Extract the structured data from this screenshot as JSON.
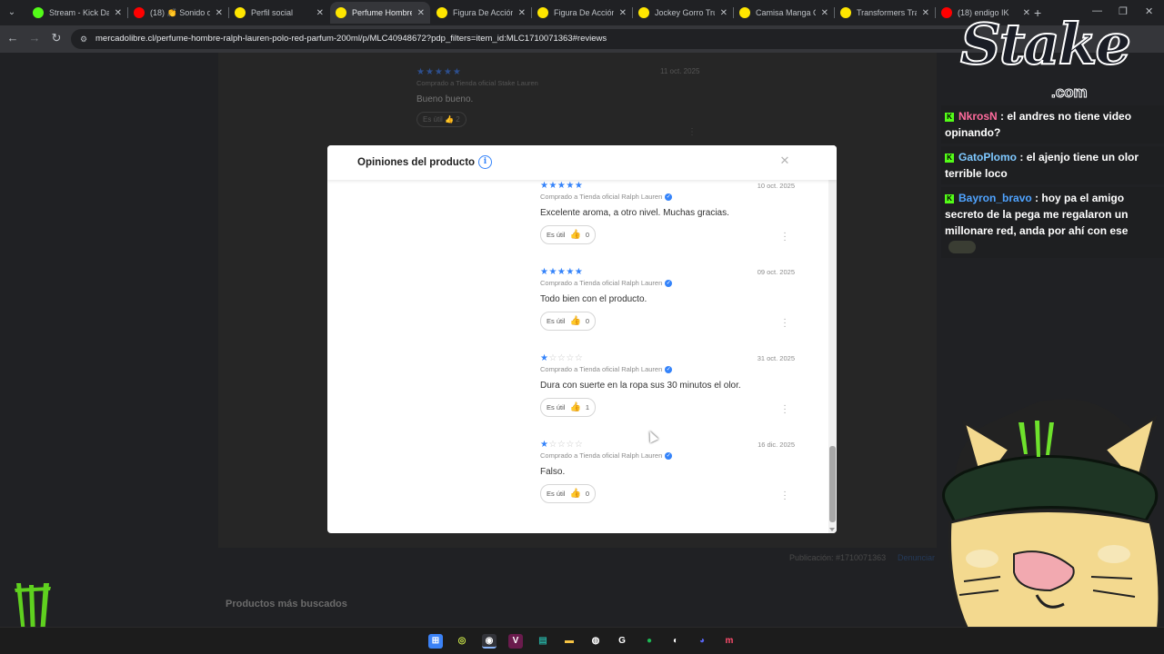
{
  "browser": {
    "tabs": [
      {
        "title": "Stream - Kick Da",
        "icon": "kick-icon",
        "color": "#53fc18"
      },
      {
        "title": "(18) 👏 Sonido d",
        "icon": "youtube-icon",
        "color": "#ff0000"
      },
      {
        "title": "Perfil social",
        "icon": "mercadolibre-icon",
        "color": "#ffe600"
      },
      {
        "title": "Perfume Hombre",
        "icon": "mercadolibre-icon",
        "color": "#ffe600"
      },
      {
        "title": "Figura De Acción",
        "icon": "mercadolibre-icon",
        "color": "#ffe600"
      },
      {
        "title": "Figura De Acción",
        "icon": "mercadolibre-icon",
        "color": "#ffe600"
      },
      {
        "title": "Jockey Gorro Truc",
        "icon": "mercadolibre-icon",
        "color": "#ffe600"
      },
      {
        "title": "Camisa Manga Co",
        "icon": "mercadolibre-icon",
        "color": "#ffe600"
      },
      {
        "title": "Transformers Tran",
        "icon": "mercadolibre-icon",
        "color": "#ffe600"
      },
      {
        "title": "(18) endigo IK",
        "icon": "youtube-icon",
        "color": "#ff0000"
      }
    ],
    "active_tab_index": 3,
    "new_tab": "+",
    "url": "mercadolibre.cl/perfume-hombre-ralph-lauren-polo-red-parfum-200ml/p/MLC40948672?pdp_filters=item_id:MLC1710071363#reviews"
  },
  "background_page": {
    "review": {
      "stars": "★★★★★",
      "date": "11 oct. 2025",
      "meta": "Comprado a Tienda oficial Stake Lauren",
      "text": "Bueno bueno.",
      "useful_label": "Es útil",
      "useful_count": "2"
    },
    "publication": "Publicación: #1710071363",
    "report": "Denunciar",
    "section_title": "Productos más buscados"
  },
  "modal": {
    "title": "Opiniones del producto",
    "close_symbol": "✕",
    "accent": "#3483fa",
    "useful_label": "Es útil",
    "reviews": [
      {
        "rating": 5,
        "stars_on": "★★★★★",
        "stars_off": "",
        "date": "10 oct. 2025",
        "meta": "Comprado a Tienda oficial Ralph Lauren",
        "text": "Excelente aroma, a otro nivel. Muchas gracias.",
        "useful": "0"
      },
      {
        "rating": 5,
        "stars_on": "★★★★★",
        "stars_off": "",
        "date": "09 oct. 2025",
        "meta": "Comprado a Tienda oficial Ralph Lauren",
        "text": "Todo bien con el producto.",
        "useful": "0"
      },
      {
        "rating": 1,
        "stars_on": "★",
        "stars_off": "☆☆☆☆",
        "date": "31 oct. 2025",
        "meta": "Comprado a Tienda oficial Ralph Lauren",
        "text": "Dura con suerte en la ropa sus 30 minutos el olor.",
        "useful": "1"
      },
      {
        "rating": 1,
        "stars_on": "★",
        "stars_off": "☆☆☆☆",
        "date": "16 dic. 2025",
        "meta": "Comprado a Tienda oficial Ralph Lauren",
        "text": "Falso.",
        "useful": "0"
      }
    ]
  },
  "overlay": {
    "sponsor": "Stake",
    "sponsor_domain": ".com",
    "chat": [
      {
        "user": "NkrosN",
        "color": "#ff6b9d",
        "message": "el andres no tiene video opinando?"
      },
      {
        "user": "GatoPlomo",
        "color": "#7ec8ff",
        "message": "el ajenjo tiene un olor terrible loco"
      },
      {
        "user": "Bayron_bravo",
        "color": "#4fa3ff",
        "message": "hoy pa el amigo secreto de la pega me regalaron un millonare red, anda por ahí con ese"
      }
    ]
  }
}
